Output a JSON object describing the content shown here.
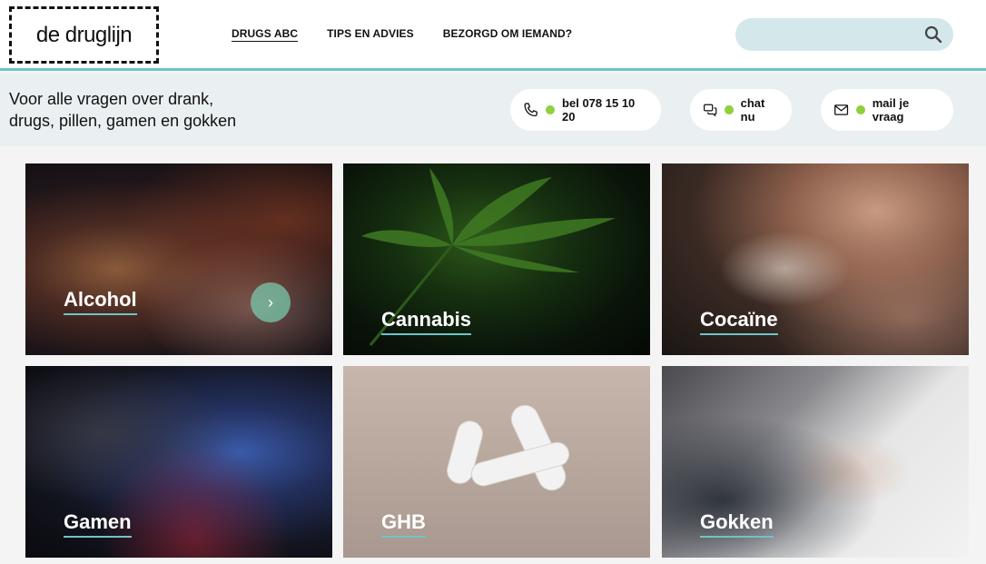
{
  "logo": {
    "text": "de druglijn"
  },
  "nav": {
    "items": [
      "DRUGS ABC",
      "TIPS EN ADVIES",
      "BEZORGD OM IEMAND?"
    ]
  },
  "search": {
    "placeholder": ""
  },
  "helpbar": {
    "tagline_line1": "Voor alle vragen over drank,",
    "tagline_line2": "drugs, pillen, gamen en gokken",
    "call_label": "bel 078 15 10 20",
    "chat_label": "chat nu",
    "mail_label": "mail je vraag"
  },
  "cards": [
    {
      "label": "Alcohol"
    },
    {
      "label": "Cannabis"
    },
    {
      "label": "Cocaïne"
    },
    {
      "label": "Gamen"
    },
    {
      "label": "GHB"
    },
    {
      "label": "Gokken"
    }
  ],
  "colors": {
    "accent": "#6fc3c9",
    "status": "#8ed13a",
    "search_bg": "#d4e8ec"
  }
}
